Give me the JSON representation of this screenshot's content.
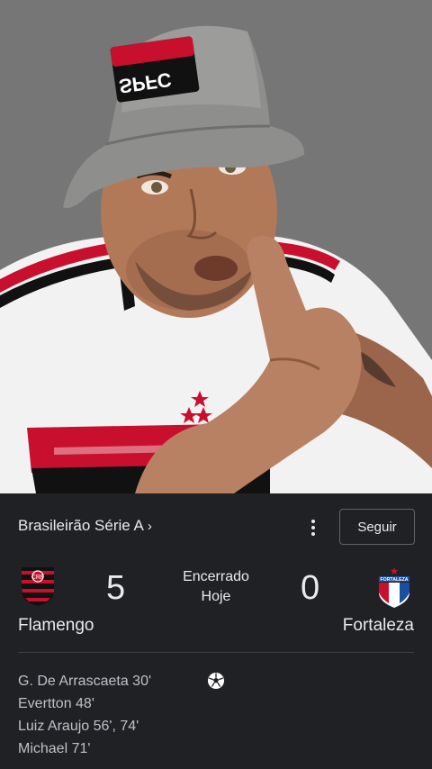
{
  "video": {
    "hat_text": "SPFC"
  },
  "match": {
    "league": "Brasileirão Série A",
    "league_chevron": "›",
    "follow_label": "Seguir",
    "status_line1": "Encerrado",
    "status_line2": "Hoje",
    "home": {
      "name": "Flamengo",
      "score": "5",
      "icon": "flamengo-crest"
    },
    "away": {
      "name": "Fortaleza",
      "score": "0",
      "icon": "fortaleza-crest",
      "crest_text": "FORTALEZA"
    },
    "scorers": [
      "G. De Arrascaeta 30'",
      "Evertton 48'",
      "Luiz Araujo 56', 74'",
      "Michael 71'"
    ],
    "goal_icon": "soccer-ball-icon"
  },
  "colors": {
    "card_bg": "#202124",
    "text_primary": "#e8eaed",
    "text_secondary": "#bdc1c6",
    "flamengo_red": "#c8102e",
    "fortaleza_blue": "#1a4fa0"
  }
}
